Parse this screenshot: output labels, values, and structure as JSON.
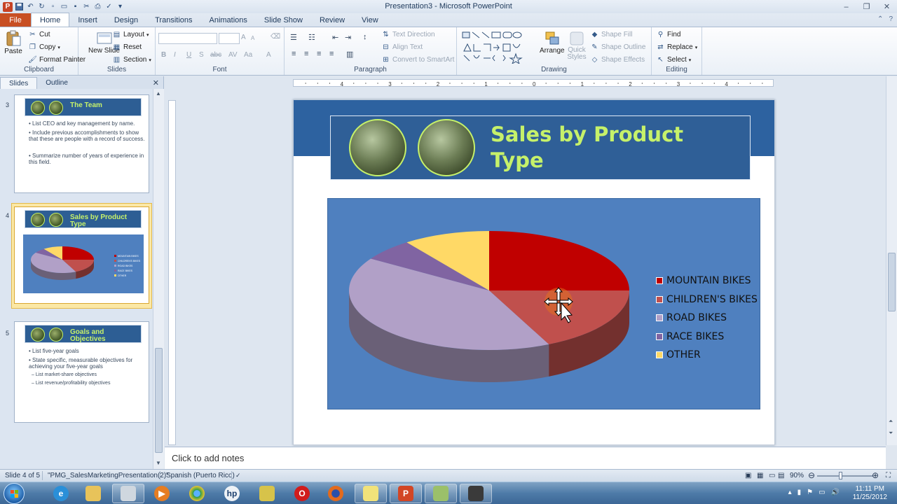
{
  "window": {
    "title": "Presentation3 - Microsoft PowerPoint",
    "app_letter": "P",
    "controls": [
      "–",
      "❐",
      "✕"
    ]
  },
  "ribbon_tabs": [
    {
      "label": "File",
      "kind": "file"
    },
    {
      "label": "Home",
      "kind": "active"
    },
    {
      "label": "Insert"
    },
    {
      "label": "Design"
    },
    {
      "label": "Transitions"
    },
    {
      "label": "Animations"
    },
    {
      "label": "Slide Show"
    },
    {
      "label": "Review"
    },
    {
      "label": "View"
    }
  ],
  "ribbon": {
    "clipboard": {
      "label": "Clipboard",
      "paste": "Paste",
      "cut": "Cut",
      "copy": "Copy",
      "format_painter": "Format Painter"
    },
    "slides": {
      "label": "Slides",
      "new_slide": "New Slide",
      "layout": "Layout",
      "reset": "Reset",
      "section": "Section"
    },
    "font": {
      "label": "Font",
      "bold": "B",
      "italic": "I",
      "underline": "U",
      "strike": "S",
      "abc": "abc",
      "grow": "A",
      "shrink": "A",
      "spacing": "AV",
      "case": "Aa",
      "color": "A"
    },
    "paragraph": {
      "label": "Paragraph",
      "text_direction": "Text Direction",
      "align_text": "Align Text",
      "convert_smartart": "Convert to SmartArt"
    },
    "drawing": {
      "label": "Drawing",
      "arrange": "Arrange",
      "quick_styles": "Quick Styles",
      "shape_fill": "Shape Fill",
      "shape_outline": "Shape Outline",
      "shape_effects": "Shape Effects"
    },
    "editing": {
      "label": "Editing",
      "find": "Find",
      "replace": "Replace",
      "select": "Select"
    }
  },
  "panel": {
    "tabs": [
      "Slides",
      "Outline"
    ],
    "slides": [
      {
        "num": "3",
        "title": "The Team",
        "bullets": [
          "List CEO  and key management by name.",
          "Include previous accomplishments to show that these are people with a record of success.",
          "Summarize number of years of experience in this field."
        ],
        "subbullets": []
      },
      {
        "num": "4",
        "title": "Sales by Product Type",
        "bullets": [],
        "subbullets": []
      },
      {
        "num": "5",
        "title": "Goals and Objectives",
        "bullets": [
          "List five-year goals",
          "State specific, measurable objectives for achieving your five-year goals"
        ],
        "subbullets": [
          "– List market-share objectives",
          "– List revenue/profitability objectives"
        ]
      }
    ]
  },
  "ruler_marks": [
    "4",
    "3",
    "2",
    "1",
    "0",
    "1",
    "2",
    "3",
    "4"
  ],
  "slide": {
    "title": "Sales by Product Type"
  },
  "chart_data": {
    "type": "pie",
    "categories": [
      "MOUNTAIN BIKES",
      "CHILDREN'S BIKES",
      "ROAD BIKES",
      "RACE BIKES",
      "OTHER"
    ],
    "values": [
      25,
      18,
      41,
      6,
      10
    ],
    "colors": [
      "#c00000",
      "#c0504d",
      "#b1a0c7",
      "#8064a2",
      "#ffd966"
    ],
    "legend_position": "right",
    "style": "3d"
  },
  "notes": {
    "placeholder": "Click to add notes"
  },
  "status": {
    "slide": "Slide 4 of 5",
    "theme": "\"PMG_SalesMarketingPresentation(2)\"",
    "language": "Spanish (Puerto Rico)",
    "zoom": "90%"
  },
  "taskbar": {
    "apps": [
      "ie",
      "explorer",
      "media",
      "chrome",
      "hp",
      "puzzle",
      "opera",
      "firefox",
      "folder",
      "powerpoint",
      "app1",
      "app2"
    ],
    "time": "11:11 PM",
    "date": "11/25/2012"
  }
}
